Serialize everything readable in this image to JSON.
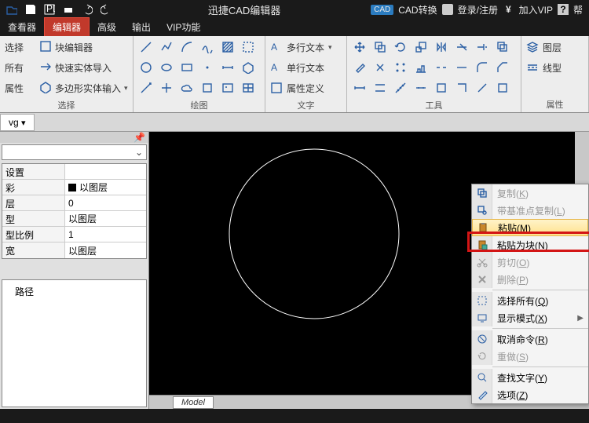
{
  "title": "迅捷CAD编辑器",
  "titlebar_right": {
    "cad_badge": "CAD",
    "convert": "CAD转换",
    "login": "登录/注册",
    "vip": "加入VIP",
    "help_trail": "帮"
  },
  "menubar": [
    "查看器",
    "编辑器",
    "高级",
    "输出",
    "VIP功能"
  ],
  "menubar_active": 1,
  "ribbon_groups": {
    "select": {
      "label": "选择",
      "items": [
        "选择",
        "所有",
        "属性"
      ],
      "right_items": [
        "块编辑器",
        "快速实体导入",
        "多边形实体输入"
      ]
    },
    "draw": {
      "label": "绘图"
    },
    "text": {
      "label": "文字",
      "items": [
        "多行文本",
        "单行文本",
        "属性定义"
      ]
    },
    "tools": {
      "label": "工具"
    },
    "props": {
      "label": "属性",
      "items": [
        "图层",
        "线型"
      ]
    }
  },
  "doctab": "vg ",
  "properties": {
    "rows": [
      {
        "key": "设置",
        "val": ""
      },
      {
        "key": "彩",
        "val": "以图层",
        "swatch": true
      },
      {
        "key": "层",
        "val": "0"
      },
      {
        "key": "型",
        "val": "以图层"
      },
      {
        "key": "型比例",
        "val": "1"
      },
      {
        "key": "宽",
        "val": "以图层"
      }
    ],
    "path_label": "路径"
  },
  "canvas": {
    "model_tab": "Model"
  },
  "context_menu": [
    {
      "label": "复制",
      "accel": "K",
      "icon": "copy",
      "enabled": false
    },
    {
      "label": "带基准点复制",
      "accel": "L",
      "icon": "copy-pt",
      "enabled": false
    },
    {
      "label": "粘贴",
      "accel": "M",
      "icon": "paste",
      "enabled": true,
      "highlight": true
    },
    {
      "label": "粘贴为块",
      "accel": "N",
      "icon": "paste-block",
      "enabled": true
    },
    {
      "label": "剪切",
      "accel": "O",
      "icon": "cut",
      "enabled": false
    },
    {
      "label": "删除",
      "accel": "P",
      "icon": "delete",
      "enabled": false
    },
    {
      "sep": true
    },
    {
      "label": "选择所有",
      "accel": "Q",
      "icon": "select-all",
      "enabled": true
    },
    {
      "label": "显示模式",
      "accel": "X",
      "icon": "display",
      "enabled": true,
      "submenu": true
    },
    {
      "sep": true
    },
    {
      "label": "取消命令",
      "accel": "R",
      "icon": "cancel",
      "enabled": true
    },
    {
      "label": "重做",
      "accel": "S",
      "icon": "redo",
      "enabled": false
    },
    {
      "sep": true
    },
    {
      "label": "查找文字",
      "accel": "Y",
      "icon": "find",
      "enabled": true
    },
    {
      "label": "选项",
      "accel": "Z",
      "icon": "options",
      "enabled": true
    }
  ]
}
